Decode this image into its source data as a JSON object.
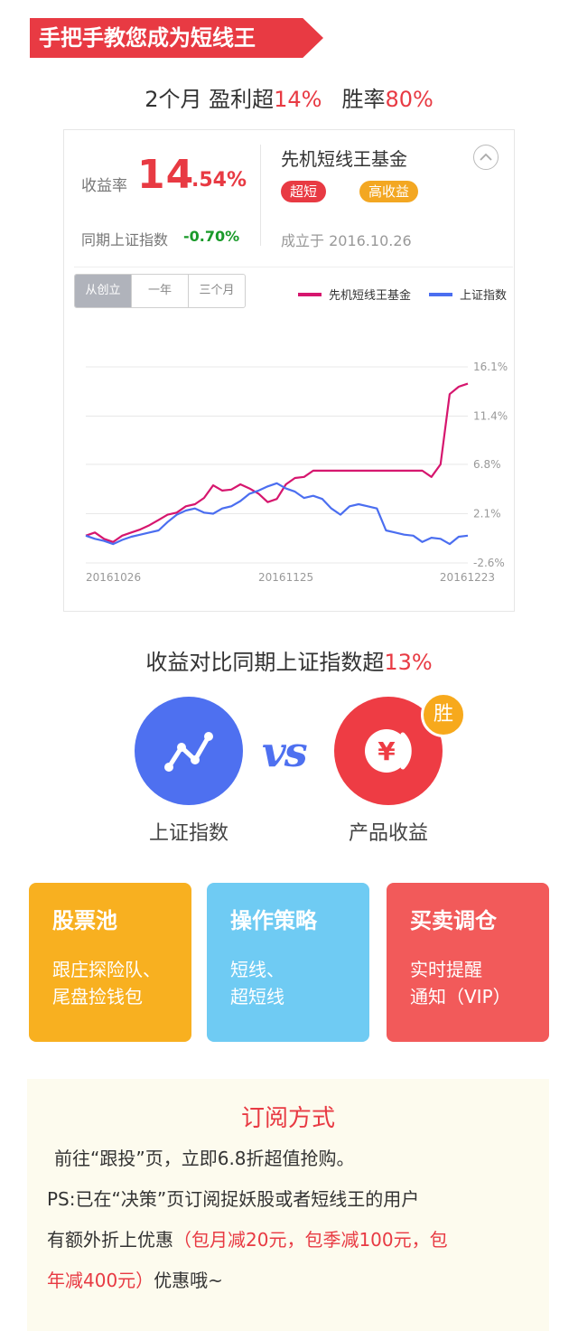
{
  "banner": {
    "title": "手把手教您成为短线王"
  },
  "headline": {
    "prefix": "2个月 盈利超",
    "profit": "14%",
    "mid": "胜率",
    "winrate": "80%"
  },
  "fund_card": {
    "yield_label": "收益率",
    "yield_int": "14",
    "yield_dec": ".54%",
    "index_label": "同期上证指数",
    "index_value": "-0.70%",
    "fund_name": "先机短线王基金",
    "tag_short": "超短",
    "tag_high": "高收益",
    "founded": "成立于 2016.10.26",
    "tabs": [
      "从创立",
      "一年",
      "三个月"
    ],
    "legend": {
      "fund": "先机短线王基金",
      "index": "上证指数"
    },
    "colors": {
      "fund": "#d6166e",
      "index": "#4b6ef0",
      "accent": "#e83a43"
    }
  },
  "chart_data": {
    "type": "line",
    "x": [
      "20161026",
      "20161027",
      "20161028",
      "20161031",
      "20161101",
      "20161102",
      "20161103",
      "20161104",
      "20161107",
      "20161108",
      "20161109",
      "20161110",
      "20161111",
      "20161114",
      "20161115",
      "20161116",
      "20161117",
      "20161118",
      "20161121",
      "20161122",
      "20161123",
      "20161124",
      "20161125",
      "20161128",
      "20161129",
      "20161130",
      "20161201",
      "20161202",
      "20161205",
      "20161206",
      "20161207",
      "20161208",
      "20161209",
      "20161212",
      "20161213",
      "20161214",
      "20161215",
      "20161216",
      "20161219",
      "20161220",
      "20161221",
      "20161222",
      "20161223"
    ],
    "x_tick_labels": [
      "20161026",
      "20161125",
      "20161223"
    ],
    "y_tick_labels": [
      "16.1%",
      "11.4%",
      "6.8%",
      "2.1%",
      "-2.6%"
    ],
    "ylim": [
      -2.6,
      16.1
    ],
    "series": [
      {
        "name": "先机短线王基金",
        "color": "#d6166e",
        "values": [
          0.0,
          0.3,
          -0.3,
          -0.6,
          0.0,
          0.3,
          0.6,
          1.0,
          1.5,
          2.0,
          2.2,
          2.8,
          3.0,
          3.6,
          4.8,
          4.3,
          4.4,
          4.9,
          4.5,
          4.0,
          3.2,
          3.5,
          4.9,
          5.5,
          5.6,
          6.2,
          6.2,
          6.2,
          6.2,
          6.2,
          6.2,
          6.2,
          6.2,
          6.2,
          6.2,
          6.2,
          6.2,
          6.2,
          5.6,
          6.8,
          13.5,
          14.2,
          14.5
        ]
      },
      {
        "name": "上证指数",
        "color": "#4b6ef0",
        "values": [
          0.0,
          -0.3,
          -0.5,
          -0.8,
          -0.4,
          -0.1,
          0.1,
          0.3,
          0.5,
          1.3,
          2.0,
          2.4,
          2.6,
          2.2,
          2.1,
          2.6,
          2.8,
          3.3,
          4.0,
          4.3,
          4.7,
          5.0,
          4.5,
          4.2,
          3.6,
          3.8,
          3.5,
          2.6,
          2.0,
          2.8,
          3.0,
          2.8,
          2.6,
          0.5,
          0.3,
          0.1,
          0.0,
          -0.6,
          -0.2,
          -0.3,
          -0.8,
          -0.1,
          0.0
        ]
      }
    ]
  },
  "compare": {
    "title_prefix": "收益对比同期上证指数超",
    "title_value": "13%",
    "vs": "vs",
    "left_label": "上证指数",
    "right_label": "产品收益",
    "win_badge": "胜",
    "currency": "¥"
  },
  "features": [
    {
      "title": "股票池",
      "lines": [
        "跟庄探险队、",
        "尾盘捡钱包"
      ]
    },
    {
      "title": "操作策略",
      "lines": [
        "短线、",
        "超短线"
      ]
    },
    {
      "title": "买卖调仓",
      "lines": [
        "实时提醒",
        "通知（VIP）"
      ]
    }
  ],
  "subscribe": {
    "title": "订阅方式",
    "line1": "前往“跟投”页，立即6.8折超值抢购。",
    "line2": "PS:已在“决策”页订阅捉妖股或者短线王的用户",
    "line3_prefix": "有额外折上优惠",
    "line3_red": "（包月减20元，包季减100元，包",
    "line4_red": "年减400元）",
    "line4_suffix": "优惠哦~"
  }
}
